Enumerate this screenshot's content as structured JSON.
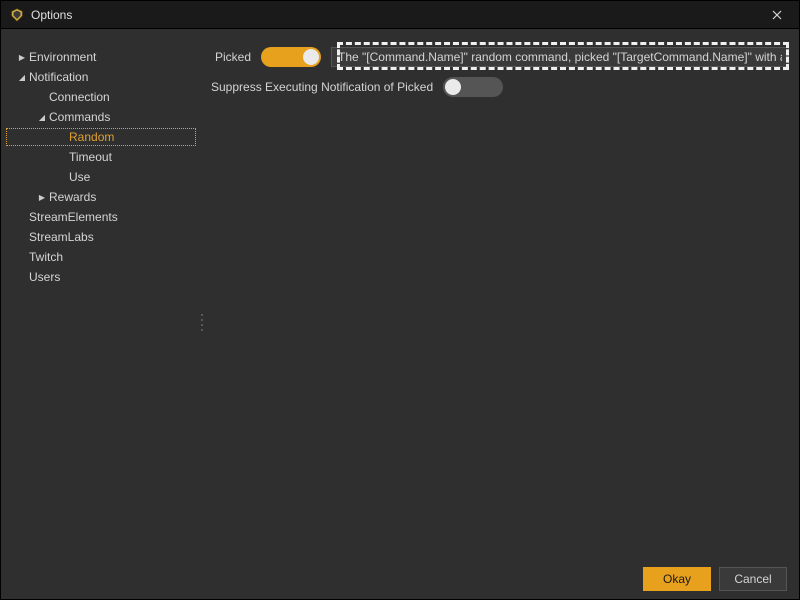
{
  "window": {
    "title": "Options"
  },
  "sidebar": {
    "items": [
      {
        "label": "Environment",
        "level": 1,
        "expander": "collapsed",
        "selected": false
      },
      {
        "label": "Notification",
        "level": 1,
        "expander": "expanded",
        "selected": false
      },
      {
        "label": "Connection",
        "level": 2,
        "expander": "none",
        "selected": false
      },
      {
        "label": "Commands",
        "level": 2,
        "expander": "expanded",
        "selected": false
      },
      {
        "label": "Random",
        "level": 3,
        "expander": "none",
        "selected": true
      },
      {
        "label": "Timeout",
        "level": 3,
        "expander": "none",
        "selected": false
      },
      {
        "label": "Use",
        "level": 3,
        "expander": "none",
        "selected": false
      },
      {
        "label": "Rewards",
        "level": 2,
        "expander": "collapsed",
        "selected": false
      },
      {
        "label": "StreamElements",
        "level": 1,
        "expander": "none",
        "selected": false
      },
      {
        "label": "StreamLabs",
        "level": 1,
        "expander": "none",
        "selected": false
      },
      {
        "label": "Twitch",
        "level": 1,
        "expander": "none",
        "selected": false
      },
      {
        "label": "Users",
        "level": 1,
        "expander": "none",
        "selected": false
      }
    ]
  },
  "form": {
    "picked_label": "Picked",
    "picked_toggle_on": true,
    "picked_input_value": "The \"[Command.Name]\" random command, picked \"[TargetCommand.Name]\" with a [Percen",
    "suppress_label": "Suppress Executing Notification of Picked",
    "suppress_toggle_on": false
  },
  "footer": {
    "ok_label": "Okay",
    "cancel_label": "Cancel"
  }
}
